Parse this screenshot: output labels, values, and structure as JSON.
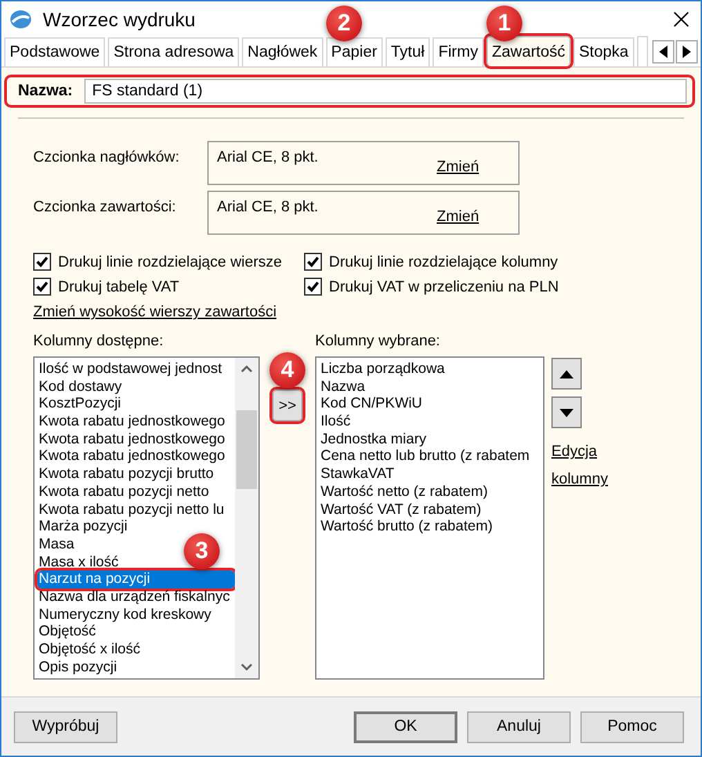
{
  "window": {
    "title": "Wzorzec wydruku"
  },
  "tabs": [
    {
      "label": "Podstawowe",
      "selected": false
    },
    {
      "label": "Strona adresowa",
      "selected": false
    },
    {
      "label": "Nagłówek",
      "selected": false
    },
    {
      "label": "Papier",
      "selected": false,
      "badge": "2"
    },
    {
      "label": "Tytuł",
      "selected": false
    },
    {
      "label": "Firmy",
      "selected": false
    },
    {
      "label": "Zawartość",
      "selected": true,
      "highlighted": true,
      "badge": "1"
    },
    {
      "label": "Stopka",
      "selected": false
    }
  ],
  "name_field": {
    "label": "Nazwa:",
    "value": "FS standard (1)",
    "highlighted": true
  },
  "fonts": [
    {
      "label": "Czcionka nagłówków:",
      "value": "Arial CE, 8 pkt.",
      "link": "Zmień"
    },
    {
      "label": "Czcionka zawartości:",
      "value": "Arial CE, 8 pkt.",
      "link": "Zmień"
    }
  ],
  "options": [
    {
      "label": "Drukuj linie rozdzielające wiersze",
      "checked": true
    },
    {
      "label": "Drukuj linie rozdzielające kolumny",
      "checked": true
    },
    {
      "label": "Drukuj tabelę VAT",
      "checked": true
    },
    {
      "label": "Drukuj VAT w przeliczeniu na PLN",
      "checked": true
    }
  ],
  "row_height_link": "Zmień wysokość wierszy zawartości",
  "available": {
    "label": "Kolumny dostępne:",
    "items": [
      {
        "text": "Ilość w podstawowej jednost",
        "selected": false
      },
      {
        "text": "Kod dostawy",
        "selected": false
      },
      {
        "text": "KosztPozycji",
        "selected": false
      },
      {
        "text": "Kwota rabatu jednostkowego",
        "selected": false
      },
      {
        "text": "Kwota rabatu jednostkowego",
        "selected": false
      },
      {
        "text": "Kwota rabatu jednostkowego",
        "selected": false
      },
      {
        "text": "Kwota rabatu pozycji brutto",
        "selected": false
      },
      {
        "text": "Kwota rabatu pozycji netto",
        "selected": false
      },
      {
        "text": "Kwota rabatu pozycji netto lu",
        "selected": false
      },
      {
        "text": "Marża pozycji",
        "selected": false
      },
      {
        "text": "Masa",
        "selected": false
      },
      {
        "text": "Masa x ilość",
        "selected": false
      },
      {
        "text": "Narzut na pozycji",
        "selected": true,
        "highlighted": true,
        "badge": "3"
      },
      {
        "text": "Nazwa dla urządzeń fiskalnyc",
        "selected": false
      },
      {
        "text": "Numeryczny kod kreskowy",
        "selected": false
      },
      {
        "text": "Objętość",
        "selected": false
      },
      {
        "text": "Objętość x ilość",
        "selected": false
      },
      {
        "text": "Opis pozycji",
        "selected": false
      }
    ]
  },
  "add_button": {
    "label": ">>",
    "highlighted": true,
    "badge": "4"
  },
  "chosen": {
    "label": "Kolumny wybrane:",
    "items": [
      {
        "text": "Liczba porządkowa"
      },
      {
        "text": "Nazwa"
      },
      {
        "text": "Kod CN/PKWiU"
      },
      {
        "text": "Ilość"
      },
      {
        "text": "Jednostka miary"
      },
      {
        "text": "Cena netto lub brutto (z rabatem"
      },
      {
        "text": "StawkaVAT"
      },
      {
        "text": "Wartość netto (z rabatem)"
      },
      {
        "text": "Wartość VAT (z rabatem)"
      },
      {
        "text": "Wartość brutto (z rabatem)"
      }
    ]
  },
  "edit_link": "Edycja kolumny",
  "buttons": [
    {
      "label": "Wypróbuj",
      "default": false
    },
    {
      "label": "OK",
      "default": true
    },
    {
      "label": "Anuluj",
      "default": false
    },
    {
      "label": "Pomoc",
      "default": false
    }
  ]
}
